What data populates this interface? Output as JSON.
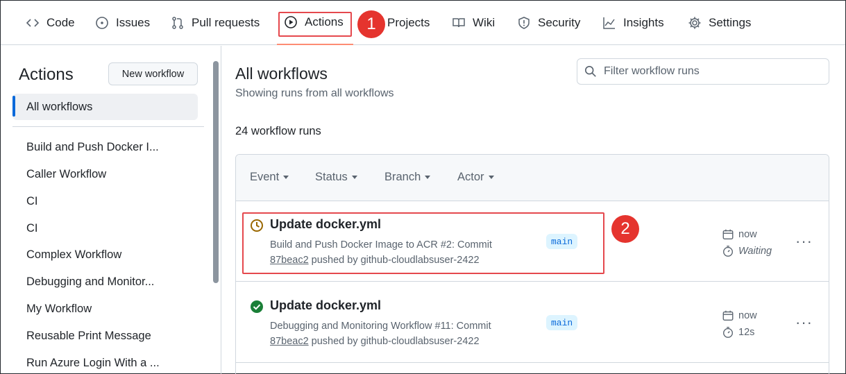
{
  "nav": {
    "tabs": [
      {
        "label": "Code",
        "icon": "code-icon"
      },
      {
        "label": "Issues",
        "icon": "issue-icon"
      },
      {
        "label": "Pull requests",
        "icon": "pull-request-icon"
      },
      {
        "label": "Actions",
        "icon": "play-icon"
      },
      {
        "label": "Projects",
        "icon": "table-icon"
      },
      {
        "label": "Wiki",
        "icon": "book-icon"
      },
      {
        "label": "Security",
        "icon": "shield-icon"
      },
      {
        "label": "Insights",
        "icon": "graph-icon"
      },
      {
        "label": "Settings",
        "icon": "gear-icon"
      }
    ],
    "active": "Actions"
  },
  "annotations": {
    "step1": "1",
    "step2": "2",
    "highlight_color": "#e5484d",
    "badge_color": "#e5342e"
  },
  "sidebar": {
    "title": "Actions",
    "new_workflow_label": "New workflow",
    "active_item": "All workflows",
    "items": [
      "Build and Push Docker I...",
      "Caller Workflow",
      "CI",
      "CI",
      "Complex Workflow",
      "Debugging and Monitor...",
      "My Workflow",
      "Reusable Print Message",
      "Run Azure Login With a ..."
    ]
  },
  "main": {
    "title": "All workflows",
    "subtitle": "Showing runs from all workflows",
    "filter_placeholder": "Filter workflow runs",
    "runs_count": "24 workflow runs",
    "filters": [
      "Event",
      "Status",
      "Branch",
      "Actor"
    ],
    "runs": [
      {
        "status": "waiting",
        "status_icon": "clock-icon",
        "status_color": "#9a6700",
        "title": "Update docker.yml",
        "description": "Build and Push Docker Image to ACR #2: Commit",
        "sha": "87beac2",
        "pushed_by": "pushed by github-cloudlabsuser-2422",
        "branch": "main",
        "time": "now",
        "duration": "Waiting"
      },
      {
        "status": "success",
        "status_icon": "check-circle-icon",
        "status_color": "#1a7f37",
        "title": "Update docker.yml",
        "description": "Debugging and Monitoring Workflow #11: Commit",
        "sha": "87beac2",
        "pushed_by": "pushed by github-cloudlabsuser-2422",
        "branch": "main",
        "time": "now",
        "duration": "12s"
      }
    ]
  }
}
